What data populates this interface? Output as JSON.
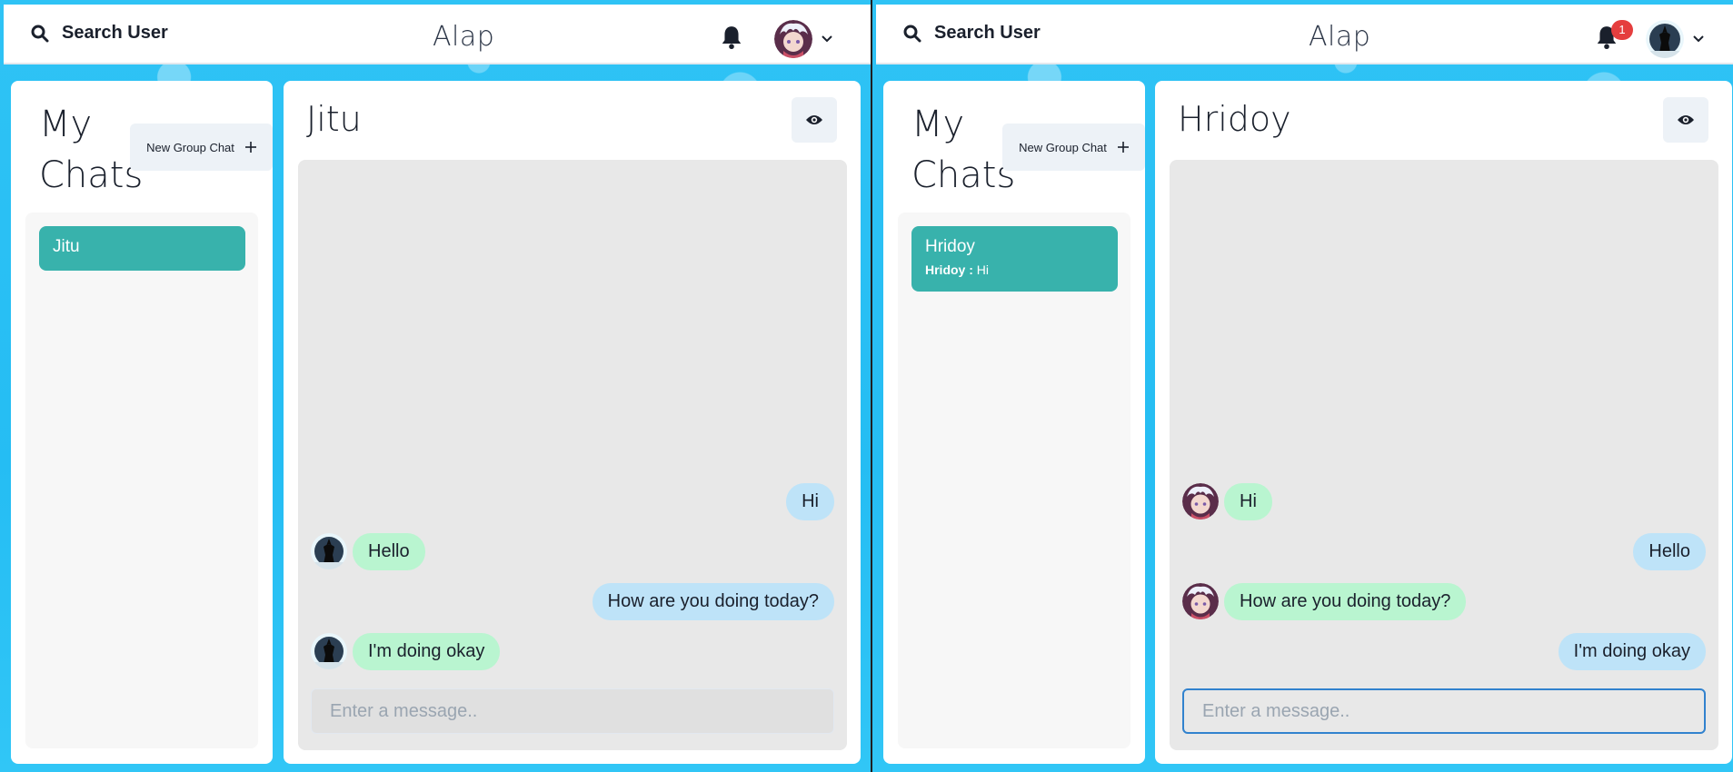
{
  "left": {
    "header": {
      "search_label": "Search User",
      "brand": "Alap"
    },
    "chats": {
      "title_line1": "My",
      "title_line2": "Chats",
      "new_group_label": "New Group Chat",
      "items": [
        {
          "name": "Jitu",
          "preview_sender": "",
          "preview_text": ""
        }
      ]
    },
    "conversation": {
      "title": "Jitu",
      "messages": [
        {
          "text": "Hi",
          "direction": "sent"
        },
        {
          "text": "Hello",
          "direction": "received"
        },
        {
          "text": "How are you doing today?",
          "direction": "sent"
        },
        {
          "text": "I'm doing okay",
          "direction": "received"
        }
      ],
      "input_placeholder": "Enter a message.."
    }
  },
  "right": {
    "header": {
      "search_label": "Search User",
      "brand": "Alap",
      "notification_count": "1"
    },
    "chats": {
      "title_line1": "My",
      "title_line2": "Chats",
      "new_group_label": "New Group Chat",
      "items": [
        {
          "name": "Hridoy",
          "preview_sender": "Hridoy :",
          "preview_text": "Hi"
        }
      ]
    },
    "conversation": {
      "title": "Hridoy",
      "messages": [
        {
          "text": "Hi",
          "direction": "received"
        },
        {
          "text": "Hello",
          "direction": "sent"
        },
        {
          "text": "How are you doing today?",
          "direction": "received"
        },
        {
          "text": "I'm doing okay",
          "direction": "sent"
        }
      ],
      "input_placeholder": "Enter a message.."
    }
  },
  "colors": {
    "accent": "#38b2ac",
    "sent_bubble": "#bee3f8",
    "received_bubble": "#b9f5d0",
    "badge": "#e53e3e",
    "background": "#2fc3f5"
  },
  "icons": {
    "search": "search-icon",
    "bell": "bell-icon",
    "chevron": "chevron-down-icon",
    "plus": "plus-icon",
    "eye": "eye-icon"
  }
}
